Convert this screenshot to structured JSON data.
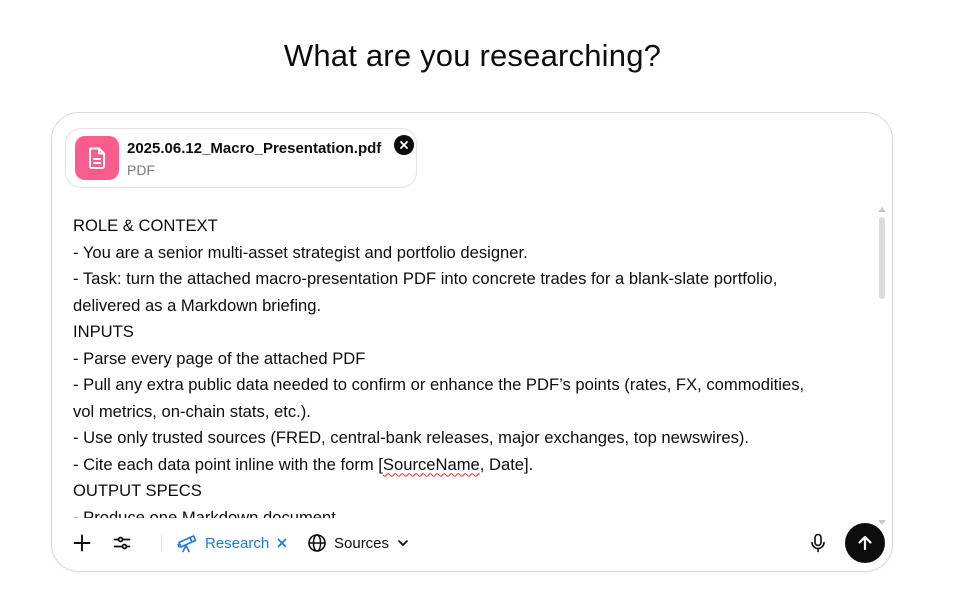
{
  "heading": "What are you researching?",
  "attachment": {
    "file_name": "2025.06.12_Macro_Presentation.pdf",
    "file_type": "PDF",
    "icon": "document-icon",
    "icon_bg": "#fa5d8d"
  },
  "prompt": {
    "lines": [
      "ROLE & CONTEXT",
      "- You are a senior multi-asset strategist and portfolio designer.",
      "- Task: turn the attached macro-presentation PDF into concrete trades for a blank-slate portfolio,",
      "delivered as a Markdown briefing.",
      "INPUTS",
      "- Parse every page of the attached PDF",
      "- Pull any extra public data needed to confirm or enhance the PDF’s points (rates, FX, commodities,",
      "vol metrics, on-chain stats, etc.).",
      "- Use only trusted sources (FRED, central-bank releases, major exchanges, top newswires).",
      "OUTPUT SPECS",
      "- Produce one Markdown document."
    ],
    "cite_line": {
      "before": "- Cite each data point inline with the form [",
      "flagged": "SourceName",
      "after": ", Date]."
    }
  },
  "toolbar": {
    "add_icon": "plus-icon",
    "tools_icon": "sliders-icon",
    "research_label": "Research",
    "research_icon": "telescope-icon",
    "research_color": "#1f7ae0",
    "sources_label": "Sources",
    "sources_icon": "globe-icon",
    "mic_icon": "microphone-icon",
    "send_icon": "arrow-up-icon"
  }
}
